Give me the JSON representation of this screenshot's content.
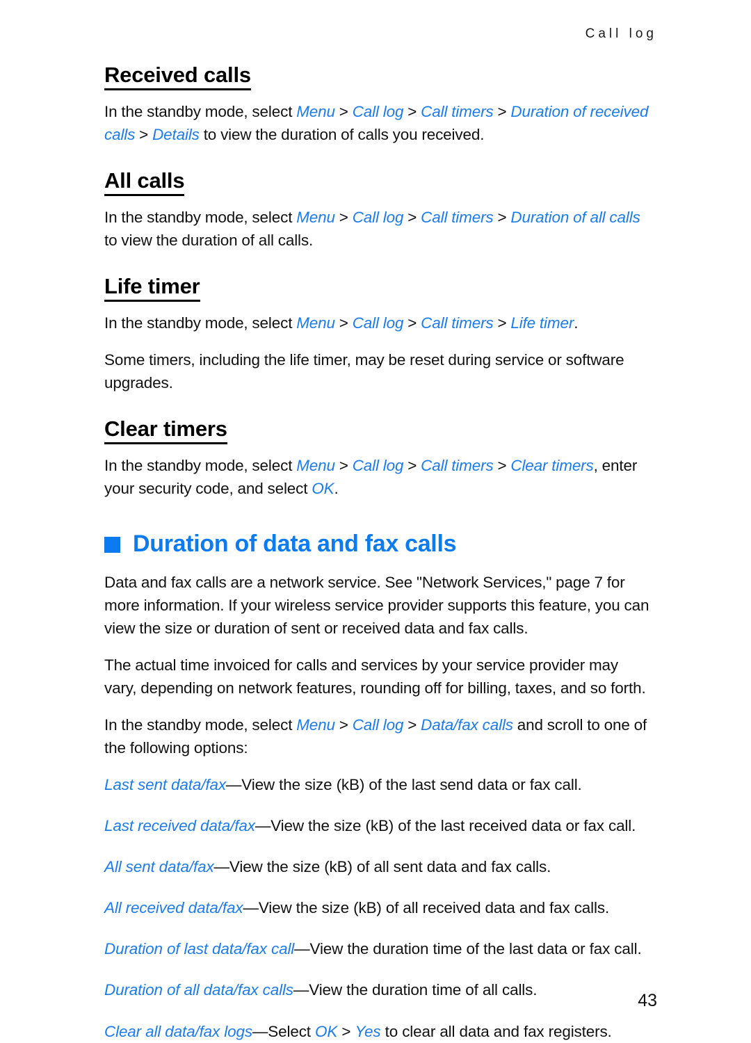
{
  "header": {
    "running_head": "Call log"
  },
  "sections": [
    {
      "heading": "Received calls",
      "paragraphs": [
        {
          "parts": [
            {
              "t": "In the standby mode, select ",
              "s": "plain"
            },
            {
              "t": "Menu",
              "s": "menu"
            },
            {
              "t": " > ",
              "s": "sep"
            },
            {
              "t": "Call log",
              "s": "menu"
            },
            {
              "t": " > ",
              "s": "sep"
            },
            {
              "t": "Call timers",
              "s": "menu"
            },
            {
              "t": " > ",
              "s": "sep"
            },
            {
              "t": "Duration of received calls",
              "s": "menu"
            },
            {
              "t": " > ",
              "s": "sep"
            },
            {
              "t": "Details",
              "s": "menu"
            },
            {
              "t": " to view the duration of calls you received.",
              "s": "plain"
            }
          ]
        }
      ]
    },
    {
      "heading": "All calls",
      "paragraphs": [
        {
          "parts": [
            {
              "t": "In the standby mode, select ",
              "s": "plain"
            },
            {
              "t": "Menu",
              "s": "menu"
            },
            {
              "t": " > ",
              "s": "sep"
            },
            {
              "t": "Call log",
              "s": "menu"
            },
            {
              "t": " > ",
              "s": "sep"
            },
            {
              "t": "Call timers",
              "s": "menu"
            },
            {
              "t": " > ",
              "s": "sep"
            },
            {
              "t": "Duration of all calls",
              "s": "menu"
            },
            {
              "t": " to view the duration of all calls.",
              "s": "plain"
            }
          ]
        }
      ]
    },
    {
      "heading": "Life timer",
      "paragraphs": [
        {
          "parts": [
            {
              "t": "In the standby mode, select ",
              "s": "plain"
            },
            {
              "t": "Menu",
              "s": "menu"
            },
            {
              "t": " > ",
              "s": "sep"
            },
            {
              "t": "Call log",
              "s": "menu"
            },
            {
              "t": " > ",
              "s": "sep"
            },
            {
              "t": "Call timers",
              "s": "menu"
            },
            {
              "t": " > ",
              "s": "sep"
            },
            {
              "t": "Life timer",
              "s": "menu"
            },
            {
              "t": ".",
              "s": "plain"
            }
          ]
        },
        {
          "parts": [
            {
              "t": "Some timers, including the life timer, may be reset during service or software upgrades.",
              "s": "plain"
            }
          ]
        }
      ]
    },
    {
      "heading": "Clear timers",
      "paragraphs": [
        {
          "parts": [
            {
              "t": "In the standby mode, select ",
              "s": "plain"
            },
            {
              "t": "Menu",
              "s": "menu"
            },
            {
              "t": " > ",
              "s": "sep"
            },
            {
              "t": "Call log",
              "s": "menu"
            },
            {
              "t": " > ",
              "s": "sep"
            },
            {
              "t": "Call timers",
              "s": "menu"
            },
            {
              "t": " > ",
              "s": "sep"
            },
            {
              "t": "Clear timers",
              "s": "menu"
            },
            {
              "t": ", enter your security code, and select ",
              "s": "plain"
            },
            {
              "t": "OK",
              "s": "menu"
            },
            {
              "t": ".",
              "s": "plain"
            }
          ]
        }
      ]
    }
  ],
  "chapter": {
    "bullet_icon": "blue-square-bullet",
    "title": "Duration of data and fax calls",
    "paragraphs": [
      {
        "parts": [
          {
            "t": "Data and fax calls are a network service. See \"Network Services,\" page 7 for more information. If your wireless service provider supports this feature, you can view the size or duration of sent or received data and fax calls.",
            "s": "plain"
          }
        ]
      },
      {
        "parts": [
          {
            "t": "The actual time invoiced for calls and services by your service provider may vary, depending on network features, rounding off for billing, taxes, and so forth.",
            "s": "plain"
          }
        ]
      },
      {
        "parts": [
          {
            "t": "In the standby mode, select ",
            "s": "plain"
          },
          {
            "t": "Menu",
            "s": "menu"
          },
          {
            "t": " > ",
            "s": "sep"
          },
          {
            "t": "Call log",
            "s": "menu"
          },
          {
            "t": " > ",
            "s": "sep"
          },
          {
            "t": "Data/fax calls",
            "s": "menu"
          },
          {
            "t": " and scroll to one of the following options:",
            "s": "plain"
          }
        ]
      }
    ],
    "options": [
      {
        "parts": [
          {
            "t": "Last sent data/fax",
            "s": "menu"
          },
          {
            "t": "—View the size (kB) of the last send data or fax call.",
            "s": "plain"
          }
        ]
      },
      {
        "parts": [
          {
            "t": "Last received data/fax",
            "s": "menu"
          },
          {
            "t": "—View the size (kB) of the last received data or fax call.",
            "s": "plain"
          }
        ]
      },
      {
        "parts": [
          {
            "t": "All sent data/fax",
            "s": "menu"
          },
          {
            "t": "—View the size (kB) of all sent data and fax calls.",
            "s": "plain"
          }
        ]
      },
      {
        "parts": [
          {
            "t": "All received data/fax",
            "s": "menu"
          },
          {
            "t": "—View the size (kB) of all received data and fax calls.",
            "s": "plain"
          }
        ]
      },
      {
        "parts": [
          {
            "t": "Duration of last data/fax call",
            "s": "menu"
          },
          {
            "t": "—View the duration time of the last data or fax call.",
            "s": "plain"
          }
        ]
      },
      {
        "parts": [
          {
            "t": "Duration of all data/fax calls",
            "s": "menu"
          },
          {
            "t": "—View the duration time of all calls.",
            "s": "plain"
          }
        ]
      },
      {
        "parts": [
          {
            "t": "Clear all data/fax logs",
            "s": "menu"
          },
          {
            "t": "—Select ",
            "s": "plain"
          },
          {
            "t": "OK",
            "s": "menu"
          },
          {
            "t": " > ",
            "s": "sep"
          },
          {
            "t": "Yes",
            "s": "menu"
          },
          {
            "t": " to clear all data and fax registers.",
            "s": "plain"
          }
        ]
      }
    ]
  },
  "footer": {
    "page_number": "43"
  },
  "colors": {
    "accent_blue": "#0d7bf0",
    "link_blue": "#1a7cf0",
    "text_black": "#111111"
  }
}
